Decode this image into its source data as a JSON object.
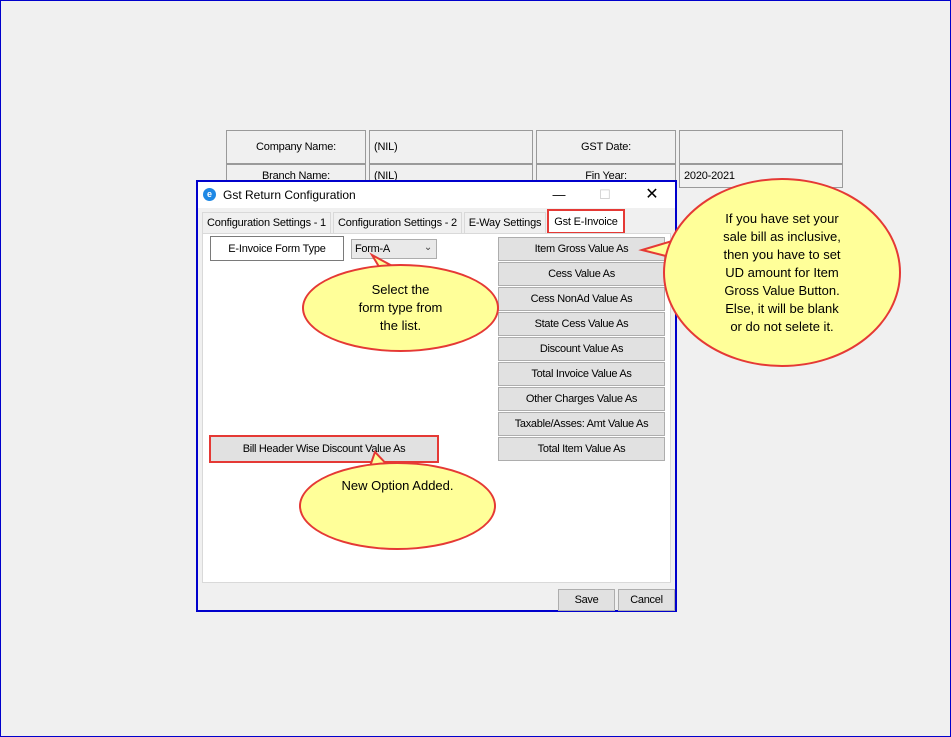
{
  "info_grid": {
    "company_label": "Company Name:",
    "company_value": "(NIL)",
    "gst_date_label": "GST Date:",
    "gst_date_value": "",
    "branch_label": "Branch Name:",
    "branch_value": "(NIL)",
    "fin_year_label": "Fin Year:",
    "fin_year_value": "2020-2021"
  },
  "dialog": {
    "title": "Gst Return Configuration",
    "app_icon": "app-logo-icon",
    "tabs": [
      {
        "label": "Configuration Settings - 1"
      },
      {
        "label": "Configuration Settings - 2"
      },
      {
        "label": "E-Way Settings"
      },
      {
        "label": "Gst E-Invoice"
      }
    ],
    "form_type_label": "E-Invoice Form Type",
    "form_type_value": "Form-A",
    "value_buttons": [
      {
        "label": "Item Gross Value As"
      },
      {
        "label": "Cess Value As"
      },
      {
        "label": "Cess NonAd Value As"
      },
      {
        "label": "State Cess Value As"
      },
      {
        "label": "Discount Value As"
      },
      {
        "label": "Total Invoice Value As"
      },
      {
        "label": "Other Charges Value As"
      },
      {
        "label": "Taxable/Asses: Amt Value As"
      },
      {
        "label": "Total Item Value As"
      }
    ],
    "bill_header_button": "Bill Header Wise Discount Value As",
    "save_label": "Save",
    "cancel_label": "Cancel"
  },
  "callouts": {
    "form_type": [
      "Select the",
      "form type from",
      "the list."
    ],
    "item_gross": [
      "If you have set your",
      "sale bill as inclusive,",
      "then you have to set",
      "UD amount for Item",
      "Gross Value Button.",
      "Else, it will be blank",
      "or do not selete it."
    ],
    "new_option": [
      "New Option Added."
    ]
  },
  "colors": {
    "callout_fill": "#ffff99",
    "highlight_red": "#e53935",
    "dialog_border": "#0000cc"
  }
}
